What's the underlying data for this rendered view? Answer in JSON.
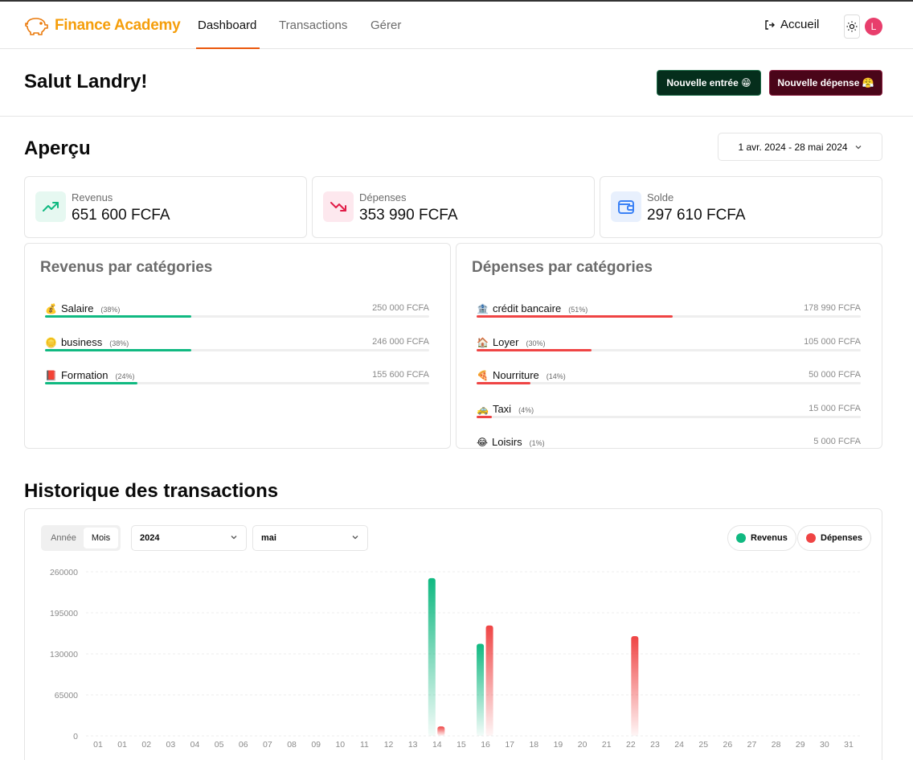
{
  "brand": {
    "name": "Finance Academy",
    "accent": "#f59e0b"
  },
  "nav": {
    "links": [
      "Dashboard",
      "Transactions",
      "Gérer"
    ],
    "active": "Dashboard",
    "home_label": "Accueil",
    "avatar_initial": "L"
  },
  "greeting": "Salut Landry!",
  "actions": {
    "new_income": "Nouvelle entrée 😁",
    "new_expense": "Nouvelle dépense 😤"
  },
  "overview": {
    "title": "Aperçu",
    "date_range": "1 avr. 2024 - 28 mai 2024",
    "stats": [
      {
        "label": "Revenus",
        "value": "651 600 FCFA",
        "icon": "trending-up-icon",
        "color": "#10b981"
      },
      {
        "label": "Dépenses",
        "value": "353 990 FCFA",
        "icon": "trending-down-icon",
        "color": "#e11d48"
      },
      {
        "label": "Solde",
        "value": "297 610 FCFA",
        "icon": "wallet-icon",
        "color": "#3b82f6"
      }
    ]
  },
  "income_categories": {
    "title": "Revenus par catégories",
    "color": "#10b981",
    "items": [
      {
        "emoji": "💰",
        "name": "Salaire",
        "pct": "(38%)",
        "pct_value": 38,
        "amount": "250 000 FCFA"
      },
      {
        "emoji": "🪙",
        "name": "business",
        "pct": "(38%)",
        "pct_value": 38,
        "amount": "246 000 FCFA"
      },
      {
        "emoji": "📕",
        "name": "Formation",
        "pct": "(24%)",
        "pct_value": 24,
        "amount": "155 600 FCFA"
      }
    ]
  },
  "expense_categories": {
    "title": "Dépenses par catégories",
    "color": "#ef4444",
    "items": [
      {
        "emoji": "🏦",
        "name": "crédit bancaire",
        "pct": "(51%)",
        "pct_value": 51,
        "amount": "178 990 FCFA"
      },
      {
        "emoji": "🏠",
        "name": "Loyer",
        "pct": "(30%)",
        "pct_value": 30,
        "amount": "105 000 FCFA"
      },
      {
        "emoji": "🍕",
        "name": "Nourriture",
        "pct": "(14%)",
        "pct_value": 14,
        "amount": "50 000 FCFA"
      },
      {
        "emoji": "🚕",
        "name": "Taxi",
        "pct": "(4%)",
        "pct_value": 4,
        "amount": "15 000 FCFA"
      },
      {
        "emoji": "😂",
        "name": "Loisirs",
        "pct": "(1%)",
        "pct_value": 1,
        "amount": "5 000 FCFA"
      }
    ]
  },
  "history": {
    "title": "Historique des transactions",
    "period_tabs": [
      "Année",
      "Mois"
    ],
    "active_tab": "Mois",
    "year_select": "2024",
    "month_select": "mai",
    "legend": [
      "Revenus",
      "Dépenses"
    ]
  },
  "chart_data": {
    "type": "bar",
    "categories": [
      "01",
      "01",
      "02",
      "03",
      "04",
      "05",
      "06",
      "07",
      "08",
      "09",
      "10",
      "11",
      "12",
      "13",
      "14",
      "15",
      "16",
      "17",
      "18",
      "19",
      "20",
      "21",
      "22",
      "23",
      "24",
      "25",
      "26",
      "27",
      "28",
      "29",
      "30",
      "31"
    ],
    "series": [
      {
        "name": "Revenus",
        "color": "#10b981",
        "values": [
          0,
          0,
          0,
          0,
          0,
          0,
          0,
          0,
          0,
          0,
          0,
          0,
          0,
          0,
          250000,
          0,
          146000,
          0,
          0,
          0,
          0,
          0,
          0,
          0,
          0,
          0,
          0,
          0,
          0,
          0,
          0,
          0
        ]
      },
      {
        "name": "Dépenses",
        "color": "#ef4444",
        "values": [
          0,
          0,
          0,
          0,
          0,
          0,
          0,
          0,
          0,
          0,
          0,
          0,
          0,
          0,
          15000,
          0,
          175000,
          0,
          0,
          0,
          0,
          0,
          158000,
          0,
          0,
          0,
          0,
          0,
          0,
          0,
          0,
          0
        ]
      }
    ],
    "yticks": [
      0,
      65000,
      130000,
      195000,
      260000
    ],
    "ylim": [
      0,
      260000
    ],
    "grid": true,
    "legend_position": "top-right"
  }
}
